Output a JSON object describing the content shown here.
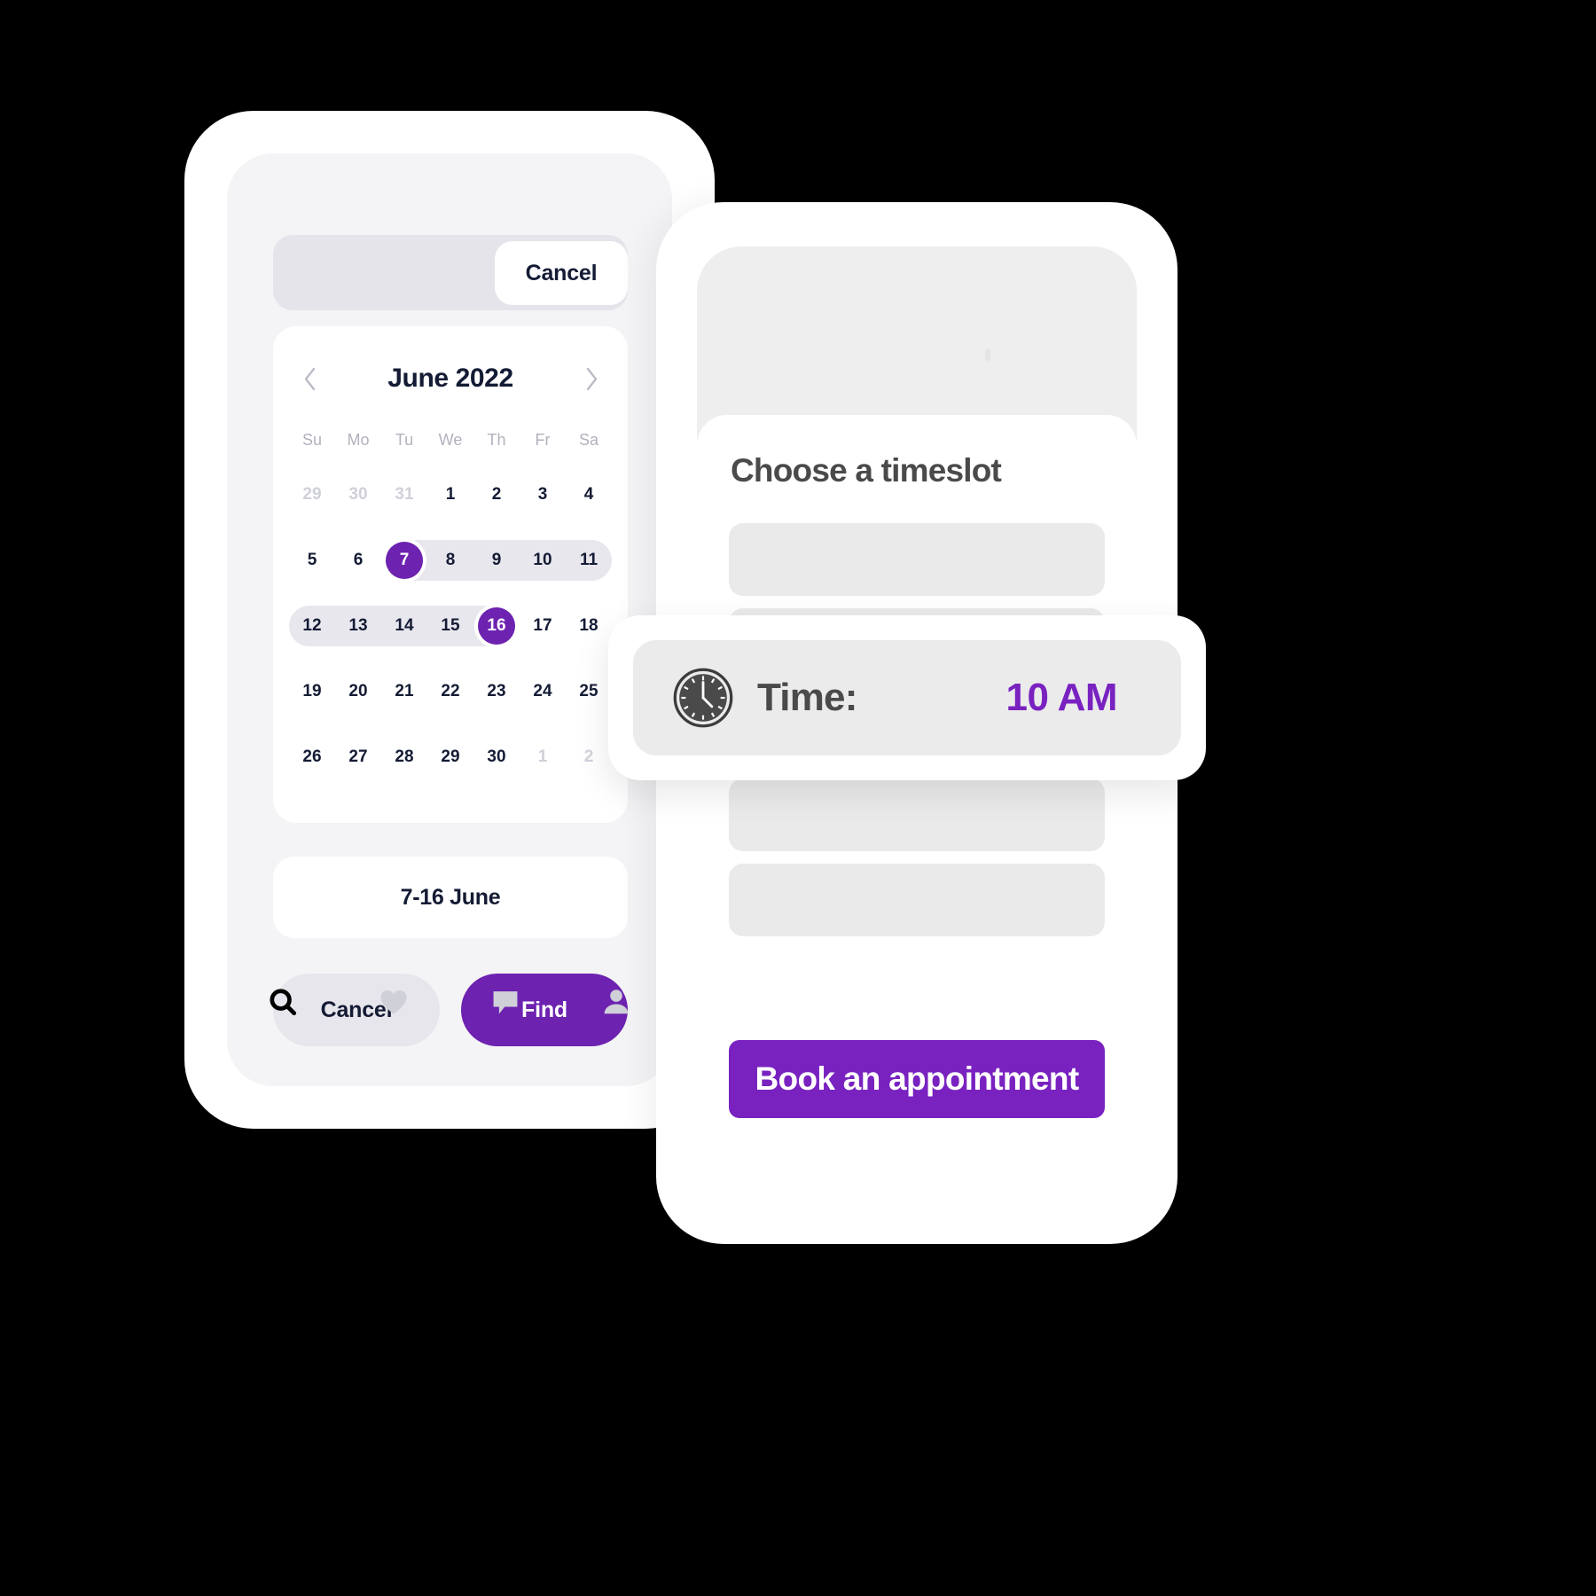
{
  "colors": {
    "accent_purple": "#6d22b0",
    "accent_purple_alt": "#7922c0",
    "dark_navy": "#141b34",
    "muted_grey": "#cfd0d8",
    "band_grey": "#e8e7ee"
  },
  "left_phone": {
    "topbar": {
      "cancel_label": "Cancel"
    },
    "calendar": {
      "title": "June 2022",
      "prev_icon": "chevron-left-icon",
      "next_icon": "chevron-right-icon",
      "weekdays": [
        "Su",
        "Mo",
        "Tu",
        "We",
        "Th",
        "Fr",
        "Sa"
      ],
      "weeks": [
        [
          {
            "d": "29",
            "state": "muted"
          },
          {
            "d": "30",
            "state": "muted"
          },
          {
            "d": "31",
            "state": "muted"
          },
          {
            "d": "1",
            "state": "normal"
          },
          {
            "d": "2",
            "state": "normal"
          },
          {
            "d": "3",
            "state": "normal"
          },
          {
            "d": "4",
            "state": "normal"
          }
        ],
        [
          {
            "d": "5",
            "state": "normal"
          },
          {
            "d": "6",
            "state": "normal"
          },
          {
            "d": "7",
            "state": "selected"
          },
          {
            "d": "8",
            "state": "normal"
          },
          {
            "d": "9",
            "state": "normal"
          },
          {
            "d": "10",
            "state": "normal"
          },
          {
            "d": "11",
            "state": "normal"
          }
        ],
        [
          {
            "d": "12",
            "state": "normal"
          },
          {
            "d": "13",
            "state": "normal"
          },
          {
            "d": "14",
            "state": "normal"
          },
          {
            "d": "15",
            "state": "normal"
          },
          {
            "d": "16",
            "state": "selected"
          },
          {
            "d": "17",
            "state": "normal"
          },
          {
            "d": "18",
            "state": "normal"
          }
        ],
        [
          {
            "d": "19",
            "state": "normal"
          },
          {
            "d": "20",
            "state": "normal"
          },
          {
            "d": "21",
            "state": "normal"
          },
          {
            "d": "22",
            "state": "normal"
          },
          {
            "d": "23",
            "state": "normal"
          },
          {
            "d": "24",
            "state": "normal"
          },
          {
            "d": "25",
            "state": "normal"
          }
        ],
        [
          {
            "d": "26",
            "state": "normal"
          },
          {
            "d": "27",
            "state": "normal"
          },
          {
            "d": "28",
            "state": "normal"
          },
          {
            "d": "29",
            "state": "normal"
          },
          {
            "d": "30",
            "state": "normal"
          },
          {
            "d": "1",
            "state": "muted"
          },
          {
            "d": "2",
            "state": "muted"
          }
        ]
      ],
      "selected_range": {
        "start_day": "7",
        "end_day": "16"
      }
    },
    "range_summary": "7-16 June",
    "buttons": {
      "cancel_label": "Cancel",
      "find_label": "Find"
    },
    "tabbar": [
      {
        "icon": "search-icon",
        "active": true
      },
      {
        "icon": "heart-icon",
        "active": false
      },
      {
        "icon": "chat-bubble-icon",
        "active": false
      },
      {
        "icon": "person-icon",
        "active": false
      }
    ]
  },
  "right_phone": {
    "title": "Choose a timeslot",
    "slot_count": 5,
    "book_button_label": "Book an appointment"
  },
  "time_card": {
    "icon": "clock-icon",
    "label": "Time:",
    "value": "10 AM"
  }
}
